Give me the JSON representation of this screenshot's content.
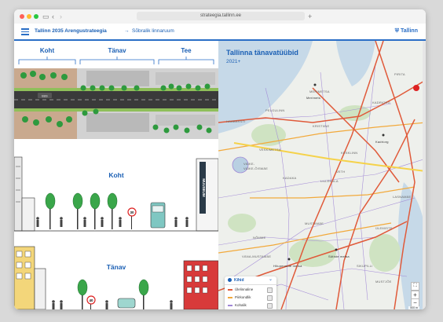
{
  "browser": {
    "url": "strateegia.tallinn.ee",
    "back_icon": "chevron-left-icon",
    "forward_icon": "chevron-right-icon",
    "sidebar_icon": "sidebar-icon",
    "new_tab_icon": "plus-icon"
  },
  "header": {
    "title": "Tallinn 2035 Arengustrateegia",
    "arrow": "→",
    "page": "Sõbralik linnaruum",
    "logo": "Tallinn",
    "accent": "#2a6ec6"
  },
  "illustration": {
    "top_labels": [
      "Koht",
      "Tänav",
      "Tee"
    ],
    "koht_label": "Koht",
    "tanav_label": "Tänav",
    "museum_label": "MUUSEUM",
    "speed_sign_1": "30",
    "speed_sign_2": "40",
    "bus_label": "BUS"
  },
  "map": {
    "title": "Tallinna tänavatüübid",
    "subtitle": "2021+",
    "district_labels": [
      "MERIMETSA",
      "PELGULINN",
      "KADRIORG",
      "HAABERSTI",
      "VÄIKE-ÕISMÄE",
      "VÄIKE-",
      "LILLEKÜLA",
      "KADAKA",
      "VÄNA-MUSTAMÄE",
      "MUSTAMÄE",
      "NÕMME",
      "ÜLEMISTE",
      "LASNAMÄE",
      "PIRITA",
      "KESKLINN",
      "KRISTIINE",
      "SIKUPILLI",
      "MUSTJÕE",
      "VESKIMETSA",
      "VETH"
    ],
    "poi_labels": [
      "Merimets",
      "Kadriorg",
      "Sütiste metsa",
      "Hiiupennide metsa"
    ],
    "legend": {
      "header": "Kihid",
      "items": [
        "Ülelinnaline",
        "Piirkondlik",
        "Kohalik"
      ]
    },
    "zoom_in": "+",
    "zoom_out": "−",
    "fullscreen_icon": "fullscreen-icon",
    "scale_text": "500 m",
    "road_colors": {
      "primary": "#e05a3a",
      "secondary": "#f2a93b",
      "local": "#a087d6"
    }
  }
}
